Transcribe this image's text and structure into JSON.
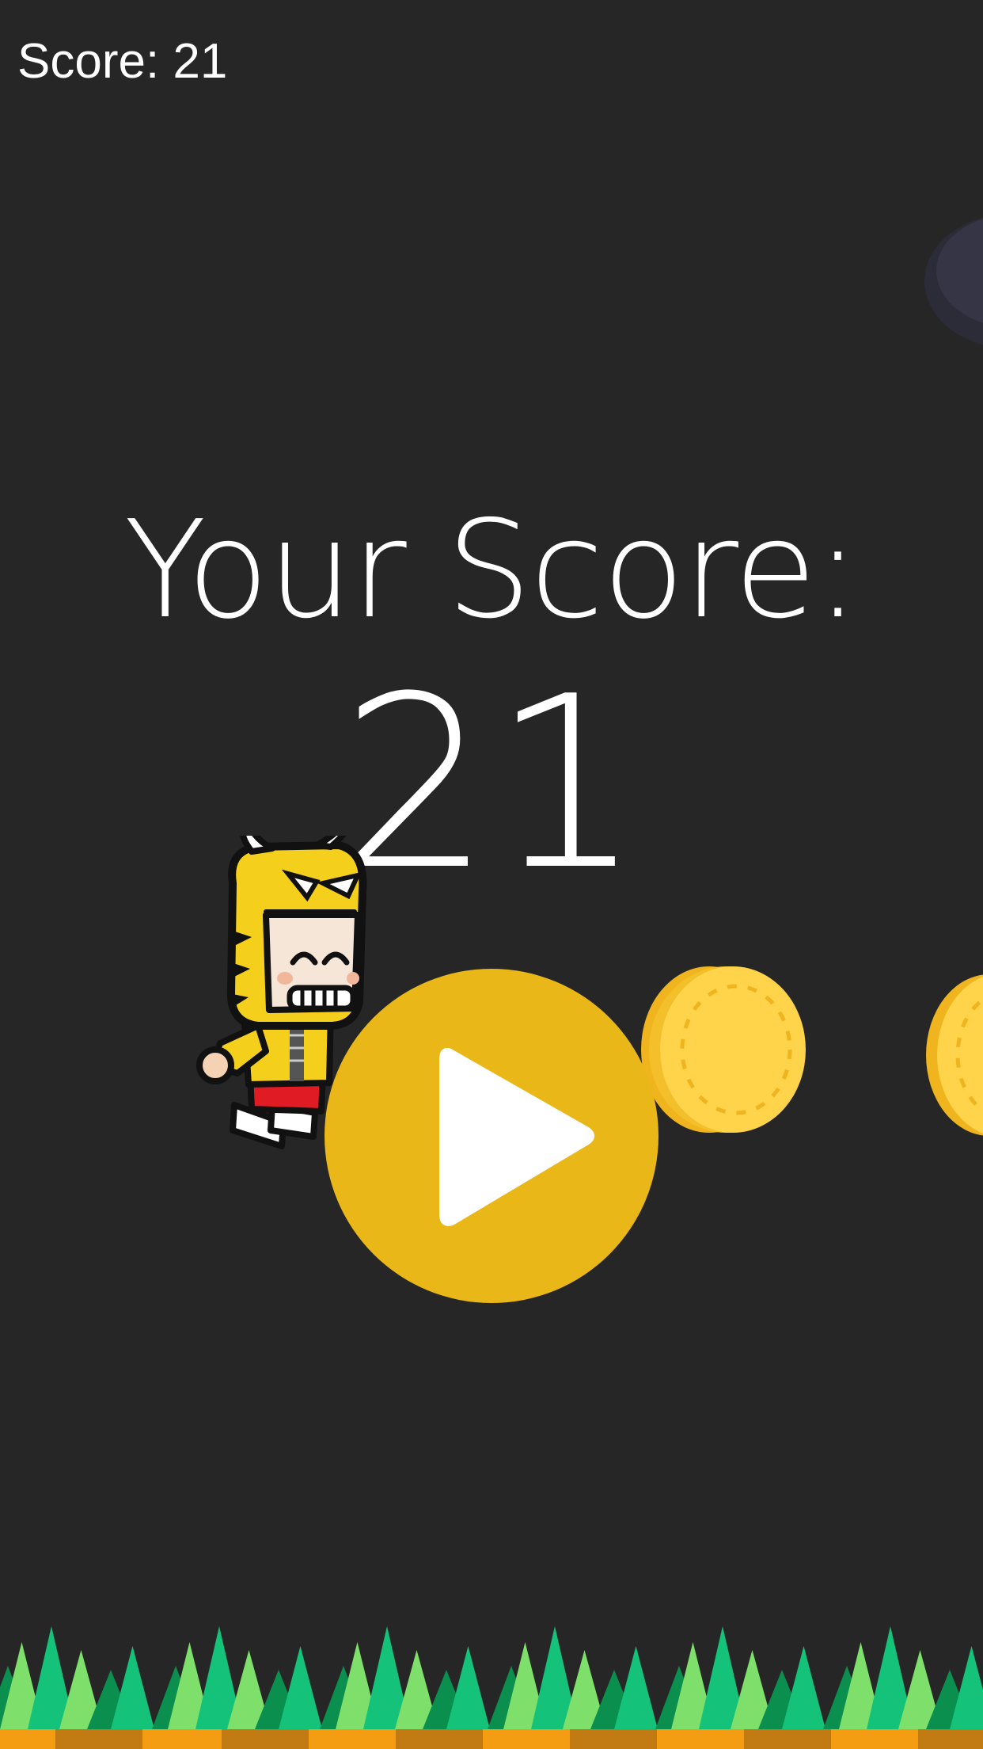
{
  "hud": {
    "score_text": "Score: 21"
  },
  "result": {
    "title": "Your Score:",
    "value": "21"
  },
  "controls": {
    "play_icon": "play-icon"
  },
  "colors": {
    "background": "#262626",
    "play_button": "#e9b718",
    "coin_face": "#ffd44a",
    "coin_edge": "#f0b51e",
    "grass_light": "#7ee06a",
    "grass_mid": "#14c27a",
    "grass_dark": "#0a8f4e",
    "dirt": "#f49d12"
  }
}
